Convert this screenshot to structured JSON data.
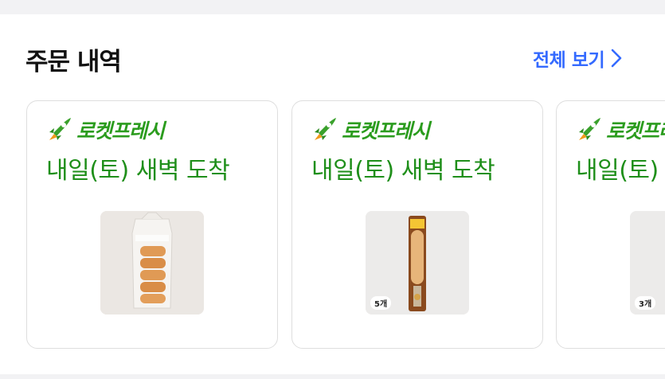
{
  "order_history": {
    "title": "주문 내역",
    "view_all": "전체 보기",
    "cards": [
      {
        "badge": "로켓프레시",
        "arrival": "내일(토) 새벽 도착",
        "product": "bread-rolls-bag"
      },
      {
        "badge": "로켓프레시",
        "arrival": "내일(토) 새벽 도착",
        "product": "sausage-stick",
        "qty_tag": "5개"
      },
      {
        "badge": "로켓프레시",
        "arrival": "내일(토) 새벽 도착",
        "product": "green-pack",
        "qty_tag": "3개"
      }
    ]
  },
  "colors": {
    "accent_blue": "#346aff",
    "rocket_green": "#2b9c1e",
    "arrival_green": "#1f8f1a"
  },
  "icons": [
    "chevron-right-icon",
    "rocket-icon"
  ]
}
